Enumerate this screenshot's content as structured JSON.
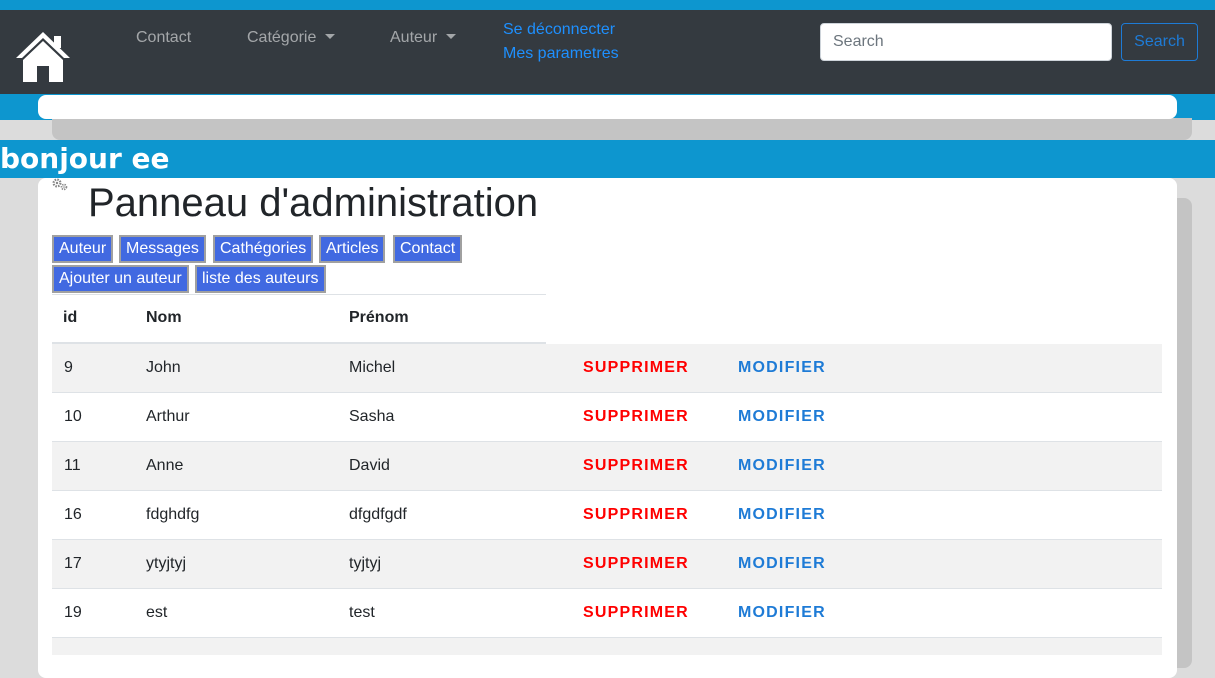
{
  "navbar": {
    "links": {
      "contact": "Contact",
      "categorie": "Catégorie",
      "auteur": "Auteur"
    },
    "account": {
      "logout": "Se déconnecter",
      "settings": "Mes parametres"
    },
    "search": {
      "placeholder": "Search",
      "button": "Search"
    }
  },
  "greeting": "bonjour ee",
  "panel": {
    "title": "Panneau d'administration",
    "buttons": {
      "auteur": "Auteur",
      "messages": "Messages",
      "categories": "Cathégories",
      "articles": "Articles",
      "contact": "Contact",
      "add_author": "Ajouter un auteur",
      "author_list": "liste des auteurs"
    },
    "table": {
      "headers": {
        "id": "id",
        "nom": "Nom",
        "prenom": "Prénom"
      },
      "delete_label": "SUPPRIMER",
      "edit_label": "MODIFIER",
      "rows": [
        {
          "id": "9",
          "nom": "John",
          "prenom": "Michel"
        },
        {
          "id": "10",
          "nom": "Arthur",
          "prenom": "Sasha"
        },
        {
          "id": "11",
          "nom": "Anne",
          "prenom": "David"
        },
        {
          "id": "16",
          "nom": "fdghdfg",
          "prenom": "dfgdfgdf"
        },
        {
          "id": "17",
          "nom": "ytyjtyj",
          "prenom": "tyjtyj"
        },
        {
          "id": "19",
          "nom": "est",
          "prenom": "test"
        }
      ]
    }
  }
}
